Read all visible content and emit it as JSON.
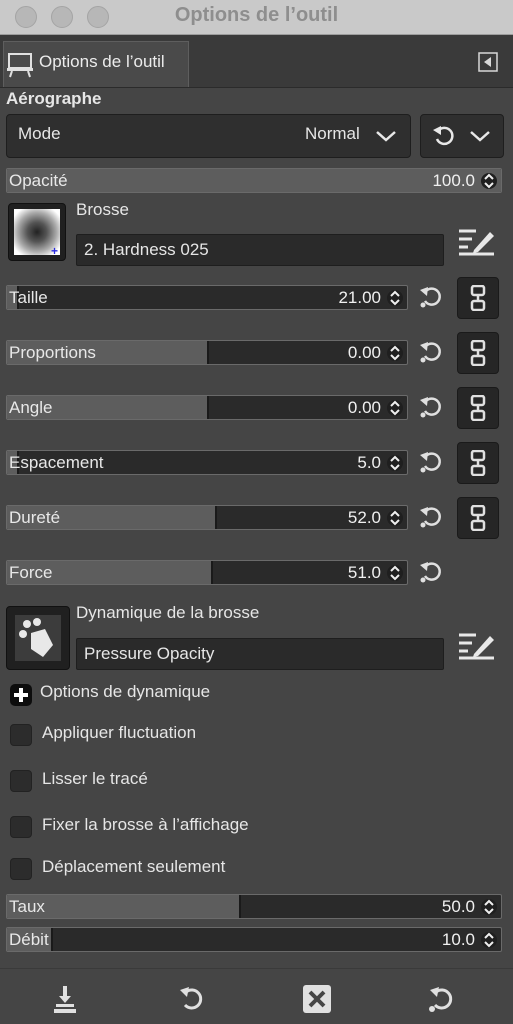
{
  "window": {
    "title": "Options de l’outil"
  },
  "tab": {
    "label": "Options de l’outil"
  },
  "section": {
    "title": "Aérographe"
  },
  "mode": {
    "label": "Mode",
    "value": "Normal"
  },
  "opacity": {
    "label": "Opacité",
    "value": "100.0",
    "level": 1.0
  },
  "brush": {
    "label": "Brosse",
    "name": "2. Hardness 025"
  },
  "sliders": [
    {
      "label": "Taille",
      "value": "21.00",
      "level": 0.01
    },
    {
      "label": "Proportions",
      "value": "0.00",
      "level": 0.5
    },
    {
      "label": "Angle",
      "value": "0.00",
      "level": 0.5
    },
    {
      "label": "Espacement",
      "value": "5.0",
      "level": 0.025
    },
    {
      "label": "Dureté",
      "value": "52.0",
      "level": 0.52
    },
    {
      "label": "Force",
      "value": "51.0",
      "level": 0.51
    }
  ],
  "dynamics": {
    "label": "Dynamique de la brosse",
    "name": "Pressure Opacity",
    "options_label": "Options de dynamique"
  },
  "checkboxes": [
    {
      "label": "Appliquer fluctuation"
    },
    {
      "label": "Lisser le tracé"
    },
    {
      "label": "Fixer la brosse à l’affichage"
    },
    {
      "label": "Déplacement seulement"
    }
  ],
  "rate": {
    "label": "Taux",
    "value": "50.0",
    "level": 0.5
  },
  "flow": {
    "label": "Débit",
    "value": "10.0",
    "level": 0.1
  },
  "icons": {
    "save": "save-preset-icon",
    "restore": "restore-icon",
    "delete": "delete-icon",
    "reset": "reset-icon"
  }
}
